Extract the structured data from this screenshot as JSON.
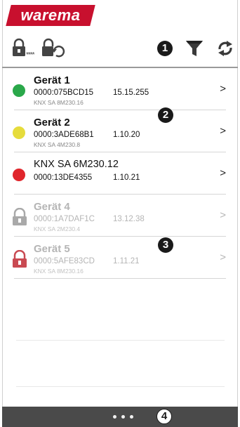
{
  "brand": {
    "logo_text": "warema"
  },
  "toolbar": {
    "password_icon": "lock-password-icon",
    "reset_lock_icon": "lock-reset-icon",
    "filter_icon": "filter-icon",
    "refresh_icon": "refresh-icon",
    "password_stars": "****",
    "callout": "1"
  },
  "callouts": {
    "c2": "2",
    "c3": "3",
    "c4": "4"
  },
  "devices": [
    {
      "name": "Gerät 1",
      "address": "0000:075BCD15",
      "group": "15.15.255",
      "model": "KNX SA 8M230.16",
      "status": "green",
      "state_color": "#2aa84a",
      "locked": false
    },
    {
      "name": "Gerät 2",
      "address": "0000:3ADE68B1",
      "group": "1.10.20",
      "model": "KNX SA 4M230.8",
      "status": "yellow",
      "state_color": "#e6dc3c",
      "locked": false
    },
    {
      "name": "KNX SA 6M230.12",
      "address": "0000:13DE4355",
      "group": "1.10.21",
      "model": "",
      "status": "red",
      "state_color": "#e0262c",
      "locked": false
    },
    {
      "name": "Gerät 4",
      "address": "0000:1A7DAF1C",
      "group": "13.12.38",
      "model": "KNX SA 2M230.4",
      "status": "locked-grey",
      "state_color": "#a9a9a9",
      "locked": true
    },
    {
      "name": "Gerät 5",
      "address": "0000:5AFE83CD",
      "group": "1.11.21",
      "model": "KNX SA 8M230.16",
      "status": "locked-red",
      "state_color": "#c94a52",
      "locked": true
    }
  ],
  "chevron": ">",
  "pager": {
    "page_count": 3
  }
}
